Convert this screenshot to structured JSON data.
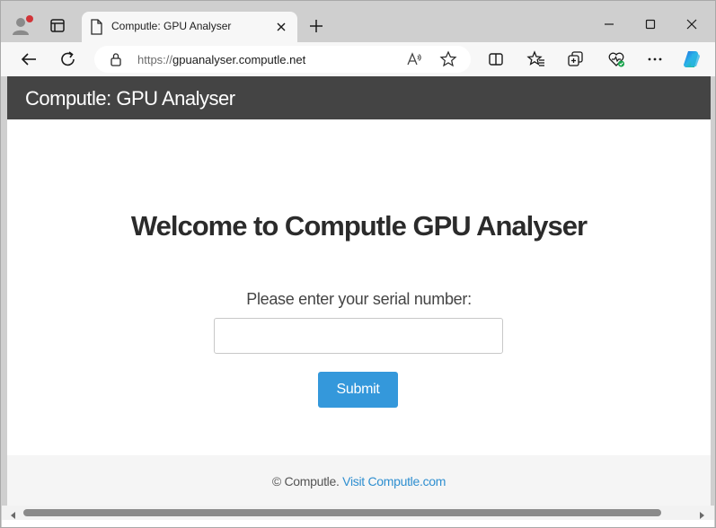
{
  "browser": {
    "tab_title": "Computle: GPU Analyser",
    "url_protocol": "https://",
    "url_host": "gpuanalyser.computle.net"
  },
  "site": {
    "header_title": "Computle: GPU Analyser",
    "welcome_heading": "Welcome to Computle GPU Analyser",
    "serial_label": "Please enter your serial number:",
    "serial_value": "",
    "submit_label": "Submit",
    "footer_copyright": "© Computle.",
    "footer_link": "Visit Computle.com"
  },
  "colors": {
    "header_bg": "#444444",
    "accent": "#3498db",
    "link": "#2f8fd0",
    "footer_bg": "#f5f5f5"
  },
  "icons": [
    "profile-icon",
    "tab-actions-icon",
    "document-icon",
    "close-icon",
    "plus-icon",
    "minimize-icon",
    "maximize-icon",
    "close-window-icon",
    "back-icon",
    "refresh-icon",
    "lock-icon",
    "read-aloud-icon",
    "favorite-star-icon",
    "split-screen-icon",
    "favorites-icon",
    "collections-icon",
    "browser-essentials-icon",
    "more-icon",
    "copilot-icon"
  ]
}
